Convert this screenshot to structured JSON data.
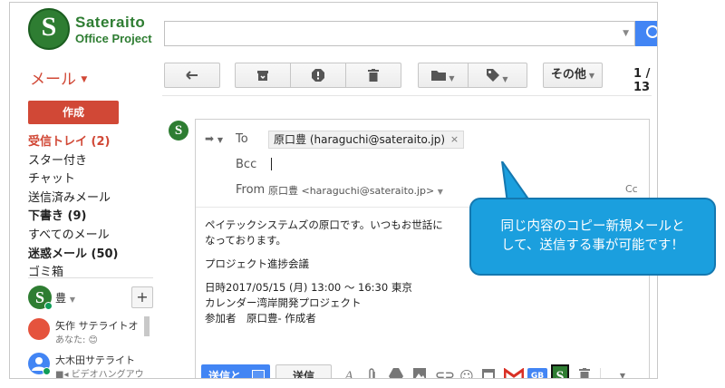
{
  "app": {
    "logo_letter": "S",
    "logo_line1": "Sateraito",
    "logo_line2": "Office Project"
  },
  "toolbar": {
    "mail_label": "メール",
    "more_label": "その他",
    "pagination": "1 / 13"
  },
  "sidebar": {
    "compose_label": "作成",
    "nav": [
      {
        "label": "受信トレイ (2)",
        "style": "active"
      },
      {
        "label": "スター付き",
        "style": ""
      },
      {
        "label": "チャット",
        "style": ""
      },
      {
        "label": "送信済みメール",
        "style": ""
      },
      {
        "label": "下書き (9)",
        "style": "bold"
      },
      {
        "label": "すべてのメール",
        "style": ""
      },
      {
        "label": "迷惑メール (50)",
        "style": "bold"
      },
      {
        "label": "ゴミ箱",
        "style": ""
      }
    ],
    "me_letter": "S",
    "me_name": "豊",
    "contacts": [
      {
        "name": "矢作 サテライトオ",
        "status": "あなた: 😊",
        "avatar_color": "#e5533d"
      },
      {
        "name": "大木田サテライト",
        "status": "ビデオハングアウ",
        "avatar_color": "#4285f4"
      }
    ]
  },
  "compose": {
    "sender_letter": "S",
    "to_label": "To",
    "to_chip": "原口豊 (haraguchi@sateraito.jp)",
    "bcc_label": "Bcc",
    "from_label": "From",
    "from_value": "原口豊 <haraguchi@sateraito.jp>",
    "cc_label": "Cc",
    "body": [
      "ペイテックシステムズの原口です。いつもお世話に",
      "なっております。",
      "",
      "プロジェクト進捗会議",
      "",
      "日時2017/05/15 (月) 13:00 ～ 16:30 東京",
      "カレンダー湾岸開発プロジェクト",
      "参加者　原口豊- 作成者"
    ],
    "send_label": "送信と",
    "send2_label": "送信"
  },
  "callout": {
    "line1": "同じ内容のコピー新規メールと",
    "line2": "して、送信する事が可能です！"
  },
  "colors": {
    "brand_green": "#2e7d32",
    "gmail_red": "#d14836",
    "send_blue": "#4285f4",
    "callout_blue": "#1b9fde"
  }
}
